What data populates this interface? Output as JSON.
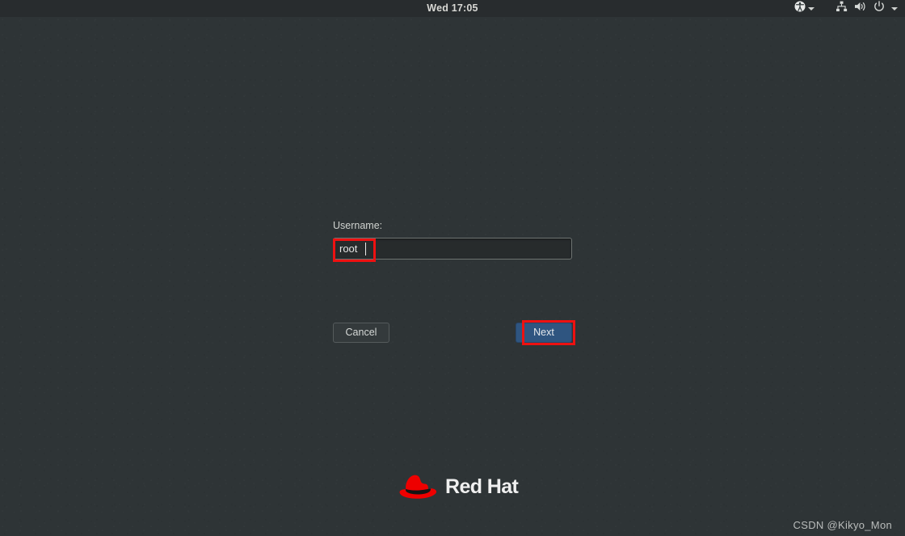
{
  "topbar": {
    "clock": "Wed 17:05",
    "accessibility_icon": "accessibility-icon",
    "accessibility_caret": "chevron-down-icon",
    "network_icon": "network-icon",
    "volume_icon": "volume-icon",
    "power_icon": "power-icon",
    "system_caret": "chevron-down-icon",
    "background_color": "#282c2e",
    "text_color": "#d8d8d4"
  },
  "login": {
    "username_label": "Username:",
    "username_value": "root",
    "username_placeholder": "",
    "cancel_label": "Cancel",
    "next_label": "Next",
    "next_button_color": "#2f5580",
    "input_background": "#272b2c"
  },
  "annotations": {
    "color": "#ee1111",
    "input_box": "highlight-username-input",
    "next_box": "highlight-next-button"
  },
  "branding": {
    "logo_name": "red-hat-logo",
    "logo_text": "Red Hat",
    "hat_color": "#ee0000",
    "band_color": "#1a1a1a"
  },
  "watermark": {
    "text": "CSDN @Kikyo_Mon"
  },
  "desktop": {
    "background_color": "#2e3436"
  }
}
